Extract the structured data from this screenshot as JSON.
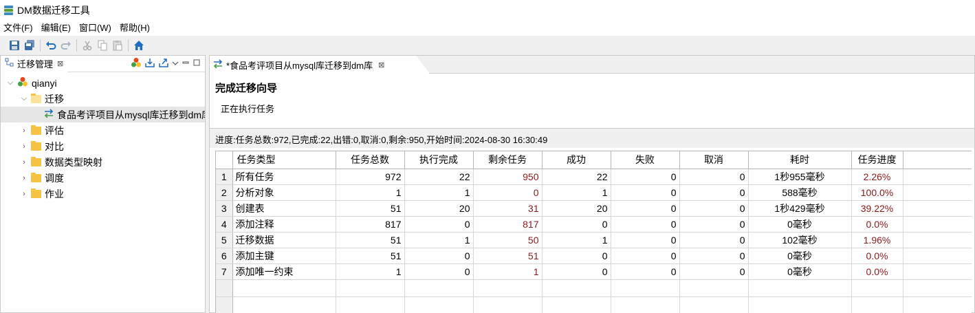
{
  "window": {
    "title": "DM数据迁移工具"
  },
  "menu": [
    "文件(F)",
    "编辑(E)",
    "窗口(W)",
    "帮助(H)"
  ],
  "toolbar_icons": [
    "save-icon",
    "save-all-icon",
    "undo-icon",
    "redo-icon",
    "cut-icon",
    "copy-icon",
    "paste-icon",
    "home-icon"
  ],
  "left": {
    "tab_label": "迁移管理",
    "tab_close": "⊠",
    "tree": {
      "root": "qianyi",
      "migration_folder": "迁移",
      "migration_item": "食品考评项目从mysql库迁移到dm库",
      "folders": [
        "评估",
        "对比",
        "数据类型映射",
        "调度",
        "作业"
      ]
    }
  },
  "right": {
    "tab_label": "*食品考评项目从mysql库迁移到dm库",
    "tab_close": "⊠",
    "wizard_title": "完成迁移向导",
    "wizard_status": "正在执行任务",
    "summary": "进度:任务总数:972,已完成:22,出错:0,取消:0,剩余:950,开始时间:2024-08-30 16:30:49"
  },
  "table": {
    "columns": [
      "任务类型",
      "任务总数",
      "执行完成",
      "剩余任务",
      "成功",
      "失败",
      "取消",
      "耗时",
      "任务进度"
    ],
    "rows": [
      {
        "n": "1",
        "type": "所有任务",
        "total": "972",
        "done": "22",
        "remain": "950",
        "success": "22",
        "fail": "0",
        "cancel": "0",
        "time": "1秒955毫秒",
        "progress": "2.26%"
      },
      {
        "n": "2",
        "type": "分析对象",
        "total": "1",
        "done": "1",
        "remain": "0",
        "success": "1",
        "fail": "0",
        "cancel": "0",
        "time": "588毫秒",
        "progress": "100.0%"
      },
      {
        "n": "3",
        "type": "创建表",
        "total": "51",
        "done": "20",
        "remain": "31",
        "success": "20",
        "fail": "0",
        "cancel": "0",
        "time": "1秒429毫秒",
        "progress": "39.22%"
      },
      {
        "n": "4",
        "type": "添加注释",
        "total": "817",
        "done": "0",
        "remain": "817",
        "success": "0",
        "fail": "0",
        "cancel": "0",
        "time": "0毫秒",
        "progress": "0.0%"
      },
      {
        "n": "5",
        "type": "迁移数据",
        "total": "51",
        "done": "1",
        "remain": "50",
        "success": "1",
        "fail": "0",
        "cancel": "0",
        "time": "102毫秒",
        "progress": "1.96%"
      },
      {
        "n": "6",
        "type": "添加主键",
        "total": "51",
        "done": "0",
        "remain": "51",
        "success": "0",
        "fail": "0",
        "cancel": "0",
        "time": "0毫秒",
        "progress": "0.0%"
      },
      {
        "n": "7",
        "type": "添加唯一约束",
        "total": "1",
        "done": "0",
        "remain": "1",
        "success": "0",
        "fail": "0",
        "cancel": "0",
        "time": "0毫秒",
        "progress": "0.0%"
      }
    ]
  },
  "colors": {
    "accent_red": "#8b1a1a",
    "folder": "#f6c342",
    "toolbar_blue": "#1e6fc0"
  }
}
